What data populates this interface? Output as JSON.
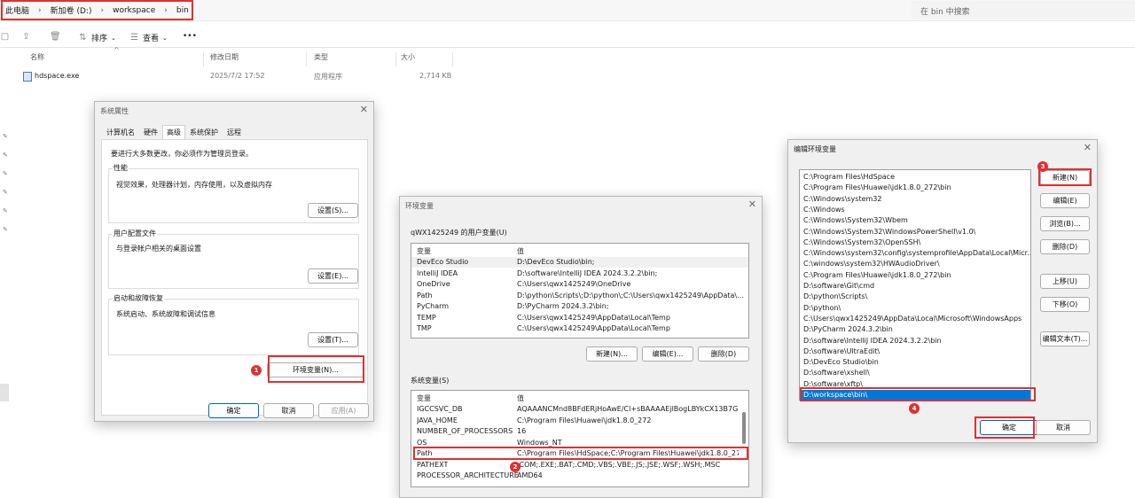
{
  "explorer": {
    "breadcrumb": [
      "此电脑",
      "新加卷 (D:)",
      "workspace",
      "bin"
    ],
    "search_placeholder": "在 bin 中搜索",
    "toolbar": {
      "sort": "排序",
      "view": "查看",
      "more": "•••"
    },
    "columns": {
      "name": "名称",
      "date": "修改日期",
      "type": "类型",
      "size": "大小"
    },
    "files": [
      {
        "name": "hdspace.exe",
        "date": "2025/7/2 17:52",
        "type": "应用程序",
        "size": "2,714 KB"
      }
    ]
  },
  "sysprops": {
    "title": "系统属性",
    "tabs": [
      "计算机名",
      "硬件",
      "高级",
      "系统保护",
      "远程"
    ],
    "admin_note": "要进行大多数更改，你必须作为管理员登录。",
    "groups": [
      {
        "title": "性能",
        "desc": "视觉效果，处理器计划，内存使用，以及虚拟内存",
        "button": "设置(S)..."
      },
      {
        "title": "用户配置文件",
        "desc": "与登录帐户相关的桌面设置",
        "button": "设置(E)..."
      },
      {
        "title": "启动和故障恢复",
        "desc": "系统启动、系统故障和调试信息",
        "button": "设置(T)..."
      }
    ],
    "env_button": "环境变量(N)...",
    "ok": "确定",
    "cancel": "取消",
    "apply": "应用(A)"
  },
  "envvars": {
    "title": "环境变量",
    "user_section": "qWX1425249 的用户变量(U)",
    "col_var": "变量",
    "col_val": "值",
    "user_vars": [
      {
        "name": "DevEco Studio",
        "value": "D:\\DevEco Studio\\bin;"
      },
      {
        "name": "IntelliJ IDEA",
        "value": "D:\\software\\IntelliJ IDEA 2024.3.2.2\\bin;"
      },
      {
        "name": "OneDrive",
        "value": "C:\\Users\\qwx1425249\\OneDrive"
      },
      {
        "name": "Path",
        "value": "D:\\python\\Scripts\\;D:\\python\\;C:\\Users\\qwx1425249\\AppData\\..."
      },
      {
        "name": "PyCharm",
        "value": "D:\\PyCharm 2024.3.2\\bin;"
      },
      {
        "name": "TEMP",
        "value": "C:\\Users\\qwx1425249\\AppData\\Local\\Temp"
      },
      {
        "name": "TMP",
        "value": "C:\\Users\\qwx1425249\\AppData\\Local\\Temp"
      }
    ],
    "user_buttons": [
      "新建(N)...",
      "编辑(E)...",
      "删除(D)"
    ],
    "sys_section": "系统变量(S)",
    "sys_vars": [
      {
        "name": "IGCCSVC_DB",
        "value": "AQAAANCMnd8BFdERjHoAwE/Cl+sBAAAAEjlBogLBYkCX13B7G..."
      },
      {
        "name": "JAVA_HOME",
        "value": "C:\\Program Files\\Huawei\\jdk1.8.0_272"
      },
      {
        "name": "NUMBER_OF_PROCESSORS",
        "value": "16"
      },
      {
        "name": "OS",
        "value": "Windows_NT"
      },
      {
        "name": "Path",
        "value": "C:\\Program Files\\HdSpace;C:\\Program Files\\Huawei\\jdk1.8.0_27..."
      },
      {
        "name": "PATHEXT",
        "value": ".COM;.EXE;.BAT;.CMD;.VBS;.VBE;.JS;.JSE;.WSF;.WSH;.MSC"
      },
      {
        "name": "PROCESSOR_ARCHITECTURE",
        "value": "AMD64"
      }
    ]
  },
  "editenv": {
    "title": "编辑环境变量",
    "entries": [
      "C:\\Program Files\\HdSpace",
      "C:\\Program Files\\Huawei\\jdk1.8.0_272\\bin",
      "C:\\Windows\\system32",
      "C:\\Windows",
      "C:\\Windows\\System32\\Wbem",
      "C:\\Windows\\System32\\WindowsPowerShell\\v1.0\\",
      "C:\\Windows\\System32\\OpenSSH\\",
      "C:\\Windows\\system32\\config\\systemprofile\\AppData\\Local\\Micr...",
      "C:\\windows\\system32\\HWAudioDriver\\",
      "C:\\Program Files\\Huawei\\jdk1.8.0_272\\bin",
      "D:\\software\\Git\\cmd",
      "D:\\python\\Scripts\\",
      "D:\\python\\",
      "C:\\Users\\qwx1425249\\AppData\\Local\\Microsoft\\WindowsApps",
      "D:\\PyCharm 2024.3.2\\bin",
      "D:\\software\\IntelliJ IDEA 2024.3.2.2\\bin",
      "D:\\software\\UltraEdit\\",
      "D:\\DevEco Studio\\bin",
      "D:\\software\\xshell\\",
      "D:\\software\\xftp\\",
      "D:\\workspace\\bin\\"
    ],
    "buttons": [
      "新建(N)",
      "编辑(E)",
      "浏览(B)...",
      "删除(D)",
      "上移(U)",
      "下移(O)",
      "编辑文本(T)..."
    ],
    "ok": "确定",
    "cancel": "取消"
  },
  "badges": [
    "1",
    "2",
    "3",
    "4"
  ],
  "colors": {
    "highlight": "#e03030",
    "selection": "#0078d7"
  }
}
